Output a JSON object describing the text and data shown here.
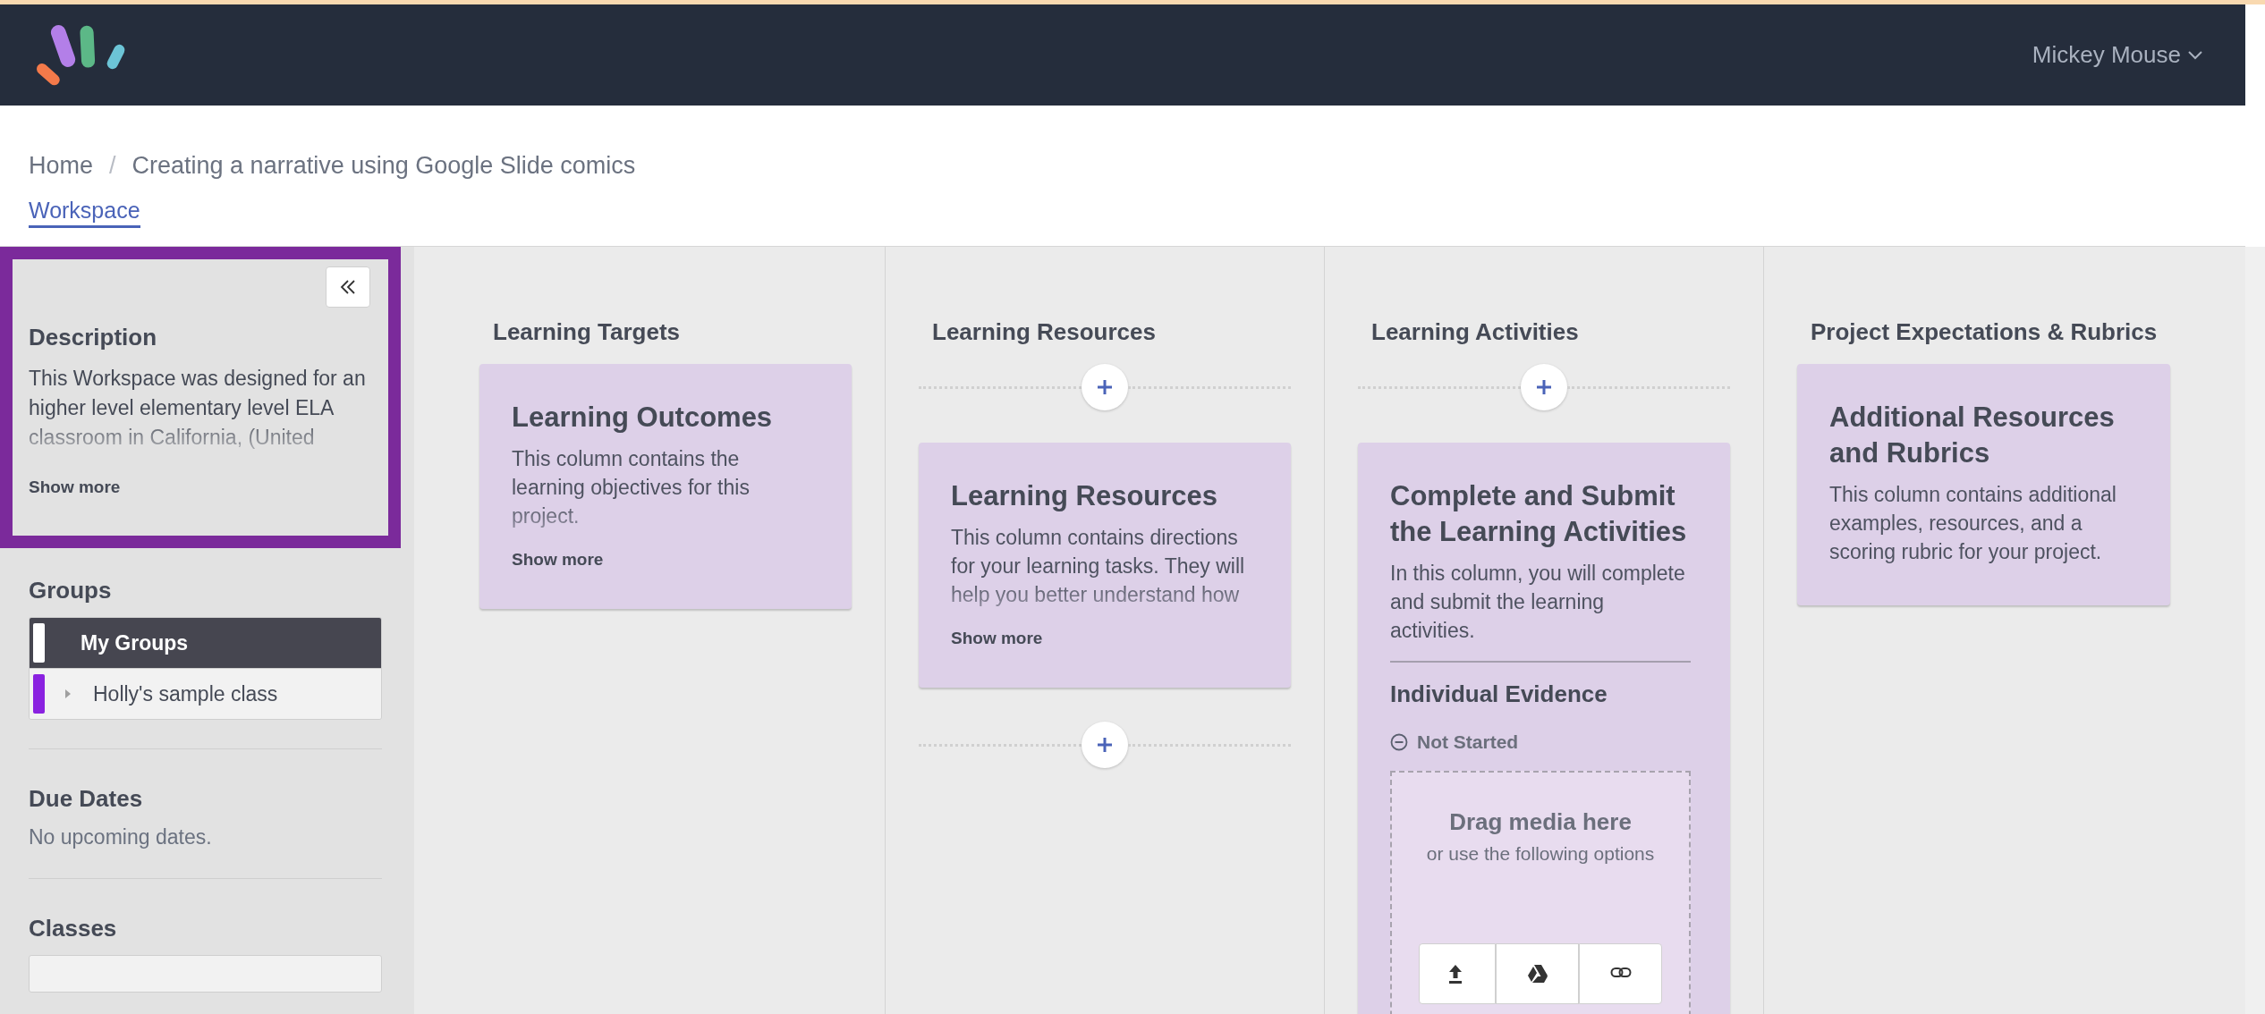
{
  "header": {
    "user_menu": "Mickey Mouse"
  },
  "breadcrumb": {
    "separator": "/",
    "items": [
      {
        "label": "Home"
      },
      {
        "label": "Creating a narrative using Google Slide comics"
      }
    ]
  },
  "tabs": [
    {
      "label": "Workspace",
      "selected": true
    }
  ],
  "sidebar": {
    "description": {
      "title": "Description",
      "text": "This Workspace was designed for an higher level elementary level ELA classroom in California, (United",
      "show_more": "Show more"
    },
    "groups": {
      "title": "Groups",
      "items": [
        {
          "label": "My Groups",
          "kind": "all",
          "selected": true,
          "color": "#ffffff"
        },
        {
          "label": "Holly's sample class",
          "kind": "group",
          "selected": false,
          "color": "#8a22e0"
        }
      ]
    },
    "due_dates": {
      "title": "Due Dates",
      "text": "No upcoming dates."
    },
    "classes": {
      "title": "Classes"
    }
  },
  "columns": [
    {
      "title": "Learning Targets",
      "items": [
        {
          "kind": "card",
          "title": "Learning Outcomes",
          "text": "This column contains the learning objectives for this project.",
          "truncated": true,
          "show_more": "Show more"
        }
      ]
    },
    {
      "title": "Learning Resources",
      "items": [
        {
          "kind": "add"
        },
        {
          "kind": "card",
          "title": "Learning Resources",
          "text": "This column contains directions for your learning tasks. They will help you better understand how",
          "truncated": true,
          "show_more": "Show more"
        },
        {
          "kind": "add"
        }
      ]
    },
    {
      "title": "Learning Activities",
      "items": [
        {
          "kind": "add"
        },
        {
          "kind": "card",
          "title": "Complete and Submit the Learning Activities",
          "text": "In this column, you will complete and submit the learning activities.",
          "truncated": false,
          "evidence": {
            "title": "Individual Evidence",
            "status": "Not Started",
            "dropzone_title": "Drag media here",
            "dropzone_subtitle": "or use the following options",
            "options": [
              {
                "kind": "upload"
              },
              {
                "kind": "drive"
              },
              {
                "kind": "link"
              }
            ]
          }
        }
      ]
    },
    {
      "title": "Project Expectations & Rubrics",
      "items": [
        {
          "kind": "card",
          "title": "Additional Resources and Rubrics",
          "text": "This column contains additional examples, resources, and a scoring rubric for your project.",
          "truncated": false
        }
      ]
    }
  ]
}
